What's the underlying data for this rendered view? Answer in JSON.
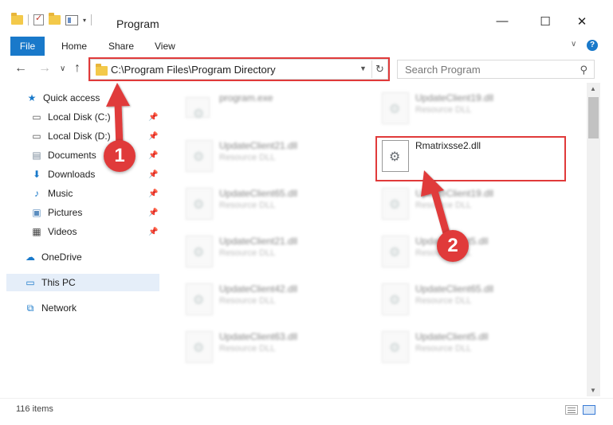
{
  "window": {
    "title": "Program",
    "minimize_glyph": "—",
    "maximize_glyph": "☐",
    "close_glyph": "✕"
  },
  "ribbon": {
    "tabs": [
      "File",
      "Home",
      "Share",
      "View"
    ],
    "expand_glyph": "∨",
    "help_glyph": "?"
  },
  "nav": {
    "back_glyph": "←",
    "forward_glyph": "→",
    "recent_glyph": "∨",
    "up_glyph": "↑",
    "address": "C:\\Program Files\\Program Directory",
    "search_placeholder": "Search Program"
  },
  "sidebar": {
    "items": [
      {
        "label": "Quick access",
        "icon": "star-icon",
        "pinned": false
      },
      {
        "label": "Local Disk (C:)",
        "icon": "drive-icon",
        "pinned": true
      },
      {
        "label": "Local Disk (D:)",
        "icon": "drive-icon",
        "pinned": true
      },
      {
        "label": "Documents",
        "icon": "documents-icon",
        "pinned": true
      },
      {
        "label": "Downloads",
        "icon": "download-icon",
        "pinned": true
      },
      {
        "label": "Music",
        "icon": "music-icon",
        "pinned": true
      },
      {
        "label": "Pictures",
        "icon": "pictures-icon",
        "pinned": true
      },
      {
        "label": "Videos",
        "icon": "videos-icon",
        "pinned": true
      },
      {
        "label": "OneDrive",
        "icon": "cloud-icon",
        "pinned": false
      },
      {
        "label": "This PC",
        "icon": "computer-icon",
        "pinned": false,
        "selected": true
      },
      {
        "label": "Network",
        "icon": "network-icon",
        "pinned": false
      }
    ]
  },
  "files": {
    "left": [
      {
        "name": "program.exe",
        "desc": ""
      },
      {
        "name": "UpdateClient21.dll",
        "desc": "Resource DLL"
      },
      {
        "name": "UpdateClient65.dll",
        "desc": "Resource DLL"
      },
      {
        "name": "UpdateClient21.dll",
        "desc": "Resource DLL"
      },
      {
        "name": "UpdateClient42.dll",
        "desc": "Resource DLL"
      },
      {
        "name": "UpdateClient63.dll",
        "desc": "Resource DLL"
      }
    ],
    "right": [
      {
        "name": "UpdateClient19.dll",
        "desc": "Resource DLL"
      },
      {
        "name": "Rmatrixsse2.dll",
        "desc": ""
      },
      {
        "name": "UpdateClient19.dll",
        "desc": "Resource DLL"
      },
      {
        "name": "UpdateClient5.dll",
        "desc": "Resource DLL"
      },
      {
        "name": "UpdateClient65.dll",
        "desc": "Resource DLL"
      },
      {
        "name": "UpdateClient5.dll",
        "desc": "Resource DLL"
      }
    ]
  },
  "status": {
    "item_count": "116 items"
  },
  "annotations": {
    "step1": "1",
    "step2": "2",
    "color": "#e03a3a"
  },
  "colors": {
    "accent": "#1979ca",
    "highlight": "#e03a3a",
    "selected_bg": "#e5eef9"
  }
}
